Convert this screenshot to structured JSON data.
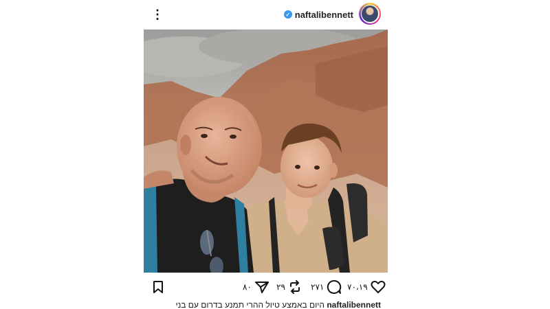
{
  "post": {
    "username": "naftalibennett",
    "verified": true,
    "caption_username": "naftalibennett",
    "caption_text": "היום באמצע טיול ההרי תמנע בדרום עם בני",
    "likes": "٧٠،١٩",
    "comments": "٢٧١",
    "reposts": "٢٩",
    "shares": "٨٠"
  },
  "colors": {
    "verified_badge": "#3897f0",
    "icon": "#111111"
  },
  "icons": [
    "more-options-icon",
    "verified-icon",
    "heart-icon",
    "comment-icon",
    "repost-icon",
    "share-icon",
    "bookmark-icon"
  ]
}
